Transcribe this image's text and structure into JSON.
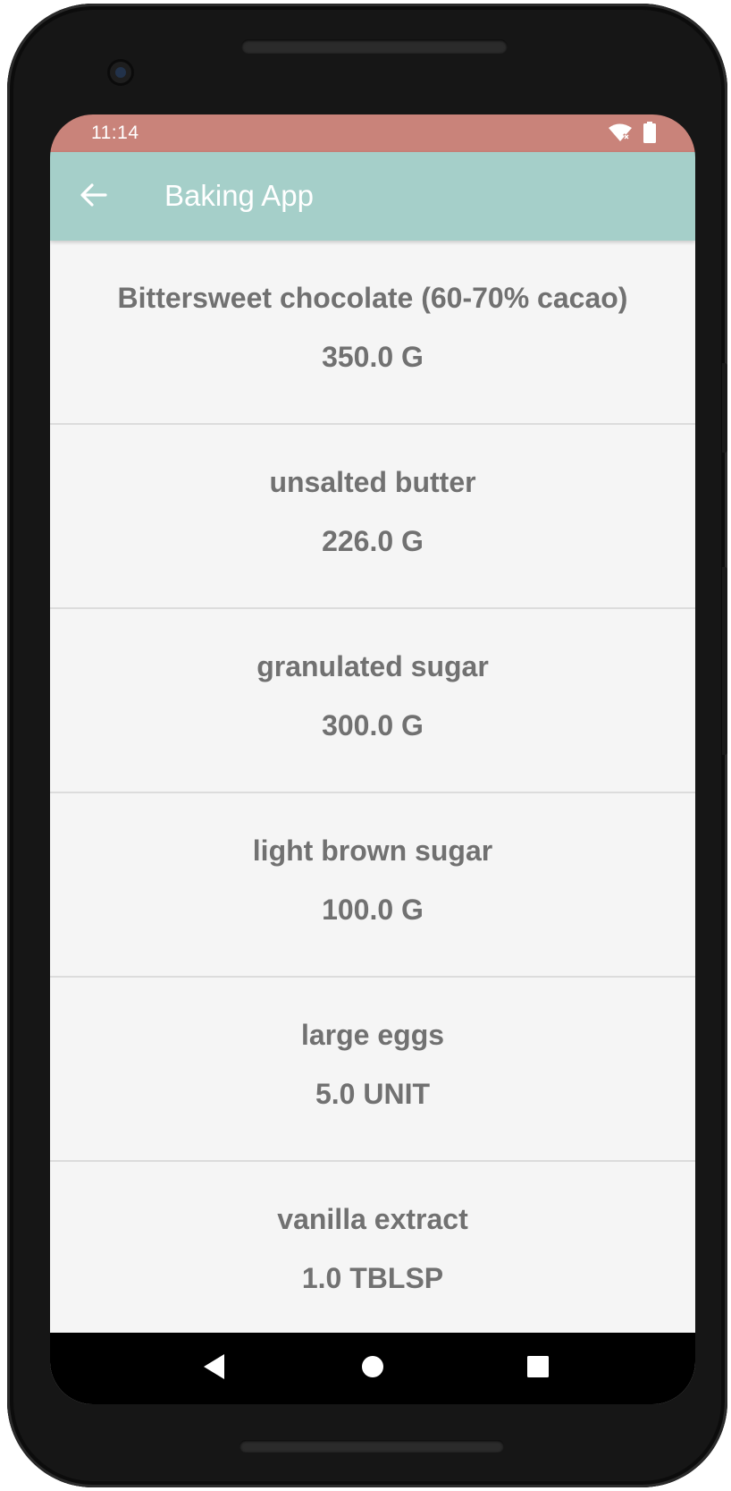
{
  "status_bar": {
    "time": "11:14",
    "icons": [
      "wifi-no-internet-icon",
      "battery-icon"
    ]
  },
  "app_bar": {
    "title": "Baking App",
    "back_icon": "arrow-back-icon"
  },
  "ingredients": [
    {
      "name": "Bittersweet chocolate (60-70% cacao)",
      "quantity": "350.0 G"
    },
    {
      "name": "unsalted butter",
      "quantity": "226.0 G"
    },
    {
      "name": "granulated sugar",
      "quantity": "300.0 G"
    },
    {
      "name": "light brown sugar",
      "quantity": "100.0 G"
    },
    {
      "name": "large eggs",
      "quantity": "5.0 UNIT"
    },
    {
      "name": "vanilla extract",
      "quantity": "1.0 TBLSP"
    }
  ],
  "nav_bar": {
    "icons": [
      "nav-back-icon",
      "nav-home-icon",
      "nav-recents-icon"
    ]
  },
  "colors": {
    "status_bar": "#c9837a",
    "app_bar": "#a5cfc9",
    "list_background": "#f5f5f5",
    "item_text": "#717171",
    "divider": "#dcdcdc"
  }
}
